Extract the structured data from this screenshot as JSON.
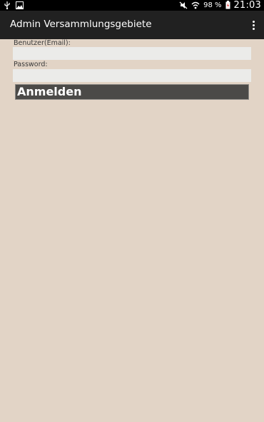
{
  "status_bar": {
    "left_icons": [
      "usb-icon",
      "image-icon"
    ],
    "right_icons": [
      "mute-icon",
      "wifi-icon",
      "battery-icon"
    ],
    "battery": "98 %",
    "time": "21:03"
  },
  "action_bar": {
    "title": "Admin Versammlungsgebiete",
    "menu_icon": "overflow-menu-icon"
  },
  "form": {
    "user_label": "Benutzer(Email):",
    "user_value": "",
    "password_label": "Password:",
    "password_value": "",
    "login_label": "Anmelden"
  },
  "colors": {
    "background": "#e2d4c6",
    "action_bar": "#212121",
    "button": "#4b4a48",
    "input": "#ebebe9"
  }
}
